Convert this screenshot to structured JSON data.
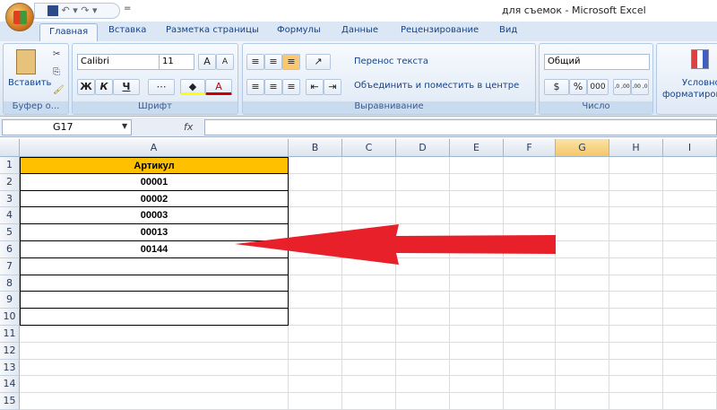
{
  "window": {
    "title": "для съемок -  Microsoft Excel"
  },
  "qat": {
    "icons": "save-icon undo-icon redo-icon",
    "more": "="
  },
  "tabs": [
    "Главная",
    "Вставка",
    "Разметка страницы",
    "Формулы",
    "Данные",
    "Рецензирование",
    "Вид"
  ],
  "ribbon": {
    "clipboard": {
      "paste": "Вставить",
      "label": "Буфер о..."
    },
    "font": {
      "name": "Calibri",
      "size": "11",
      "grow": "A",
      "shrink": "A",
      "bold": "Ж",
      "italic": "К",
      "underline": "Ч",
      "font_color": "A",
      "label": "Шрифт"
    },
    "alignment": {
      "wrap": "Перенос текста",
      "merge": "Объединить и поместить в центре",
      "label": "Выравнивание"
    },
    "number": {
      "format": "Общий",
      "percent": "%",
      "thousands": "000",
      "inc_dec": ",0 ,00",
      "dec_dec": ",00 ,0",
      "label": "Число"
    },
    "styles": {
      "cond_format_1": "Условно",
      "cond_format_2": "форматиров"
    }
  },
  "formula_bar": {
    "name_box": "G17",
    "fx": "fx",
    "value": ""
  },
  "sheet": {
    "columns": [
      "A",
      "B",
      "C",
      "D",
      "E",
      "F",
      "G",
      "H",
      "I"
    ],
    "rows": [
      "1",
      "2",
      "3",
      "4",
      "5",
      "6",
      "7",
      "8",
      "9",
      "10",
      "11",
      "12",
      "13",
      "14",
      "15"
    ],
    "header": "Артикул",
    "values": [
      "00001",
      "00002",
      "00003",
      "00013",
      "00144"
    ],
    "header_color": "#ffc000",
    "arrow_color": "#e8202a"
  }
}
